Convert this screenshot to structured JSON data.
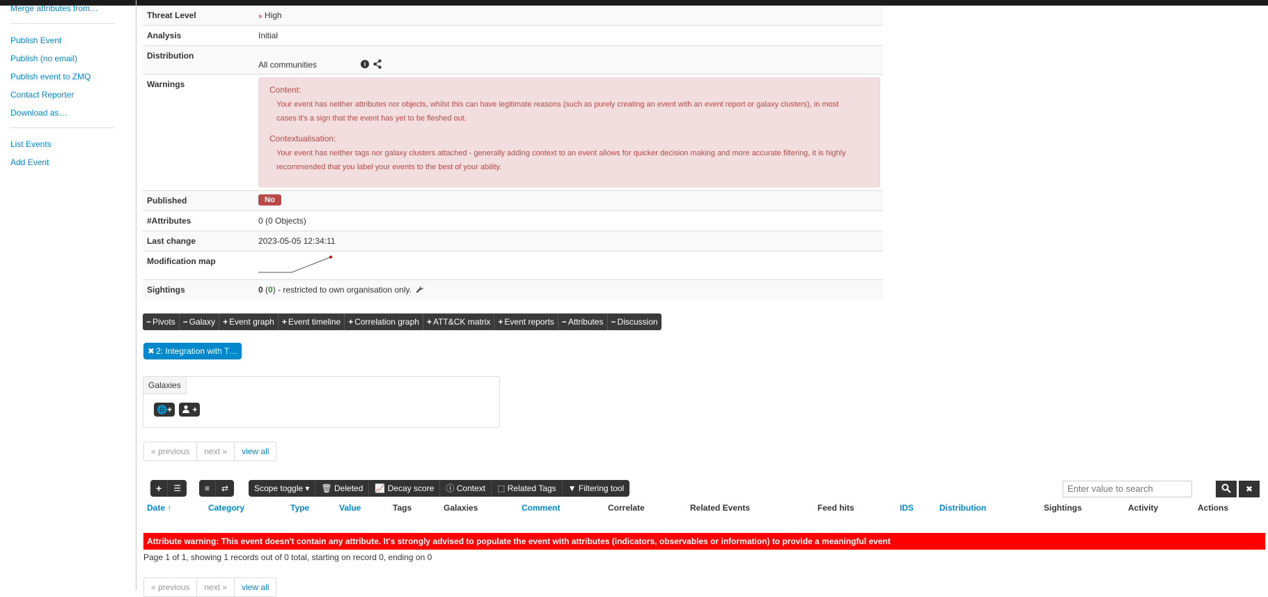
{
  "sidebar": {
    "items_top": [
      "Merge attributes from…"
    ],
    "items_publish": [
      "Publish Event",
      "Publish (no email)",
      "Publish event to ZMQ",
      "Contact Reporter",
      "Download as…"
    ],
    "items_bottom": [
      "List Events",
      "Add Event"
    ]
  },
  "details": {
    "threat_level": {
      "label": "Threat Level",
      "value": "High",
      "icon": "chevrons-up-icon"
    },
    "analysis": {
      "label": "Analysis",
      "value": "Initial"
    },
    "distribution": {
      "label": "Distribution",
      "value": "All communities"
    },
    "warnings": {
      "label": "Warnings",
      "content_title": "Content:",
      "content_text": "Your event has neither attributes nor objects, whilst this can have legitimate reasons (such as purely creating an event with an event report or galaxy clusters), in most cases it's a sign that the event has yet to be fleshed out.",
      "context_title": "Contextualisation:",
      "context_text": "Your event has neither tags nor galaxy clusters attached - generally adding context to an event allows for quicker decision making and more accurate filtering, it is highly recommended that you label your events to the best of your ability."
    },
    "published": {
      "label": "Published",
      "value": "No"
    },
    "attributes": {
      "label": "#Attributes",
      "value": "0 (0 Objects)"
    },
    "last_change": {
      "label": "Last change",
      "value": "2023-05-05 12:34:11"
    },
    "modification_map": {
      "label": "Modification map"
    },
    "sightings": {
      "label": "Sightings",
      "count": "0",
      "paren_open": " (",
      "own": "0",
      "paren_close": ")",
      "suffix": " - restricted to own organisation only."
    }
  },
  "tabs": [
    {
      "sym": "−",
      "label": "Pivots"
    },
    {
      "sym": "−",
      "label": "Galaxy"
    },
    {
      "sym": "+",
      "label": "Event graph"
    },
    {
      "sym": "+",
      "label": "Event timeline"
    },
    {
      "sym": "+",
      "label": "Correlation graph"
    },
    {
      "sym": "+",
      "label": "ATT&CK matrix"
    },
    {
      "sym": "+",
      "label": "Event reports"
    },
    {
      "sym": "−",
      "label": "Attributes"
    },
    {
      "sym": "−",
      "label": "Discussion"
    }
  ],
  "pivot_tag": "2: Integration with T…",
  "galaxies": {
    "title": "Galaxies"
  },
  "pager": {
    "previous": "« previous",
    "next": "next »",
    "view_all": "view all"
  },
  "toolbar": {
    "scope_toggle": "Scope toggle",
    "deleted": "Deleted",
    "decay_score": "Decay score",
    "context": "Context",
    "related_tags": "Related Tags",
    "filtering_tool": "Filtering tool"
  },
  "search": {
    "placeholder": "Enter value to search"
  },
  "table_headers": [
    "Date",
    "Category",
    "Type",
    "Value",
    "Tags",
    "Galaxies",
    "Comment",
    "Correlate",
    "Related Events",
    "Feed hits",
    "IDS",
    "Distribution",
    "Sightings",
    "Activity",
    "Actions"
  ],
  "attribute_warning": "Attribute warning: This event doesn't contain any attribute. It's strongly advised to populate the event with attributes (indicators, observables or information) to provide a meaningful event",
  "page_info": "Page 1 of 1, showing 1 records out of 0 total, starting on record 0, ending on 0",
  "colors": {
    "link": "#0088cc",
    "danger": "#b94a48",
    "warning_bg": "#f2dede",
    "attr_warning_bg": "#ff0000",
    "dark_toolbar": "#333333"
  }
}
